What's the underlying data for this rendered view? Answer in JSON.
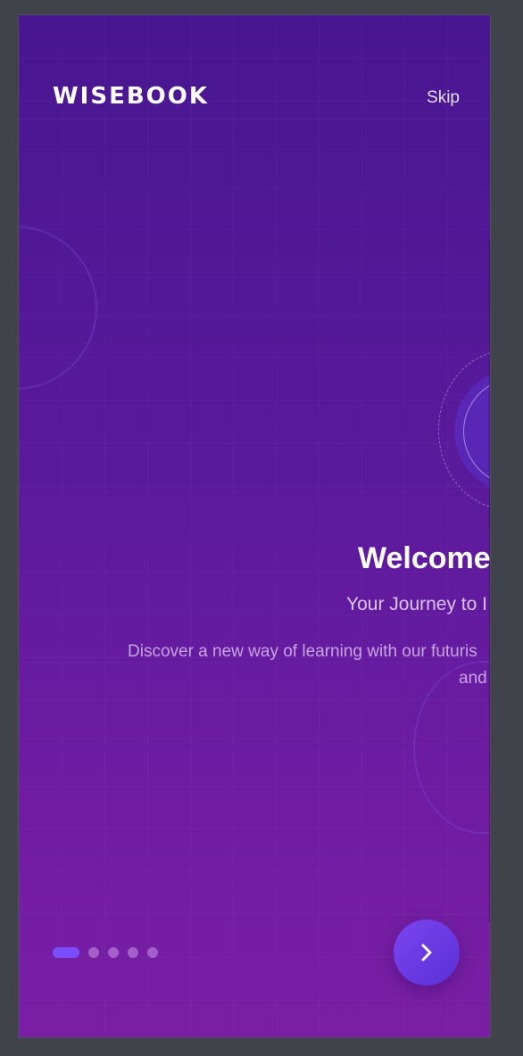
{
  "header": {
    "brand": "WISEBOOK",
    "skip_label": "Skip"
  },
  "slide": {
    "title": "Welcome",
    "subtitle": "Your Journey to I",
    "description_line1": "Discover a new way of learning with our futuris",
    "description_line2": "and"
  },
  "pagination": {
    "total": 5,
    "active_index": 0
  },
  "next_button": {
    "icon": "chevron-right-icon"
  },
  "colors": {
    "background_top": "#481690",
    "background_bottom": "#7a1fa4",
    "accent": "#7a4dff",
    "button": "#6a3ae3"
  }
}
